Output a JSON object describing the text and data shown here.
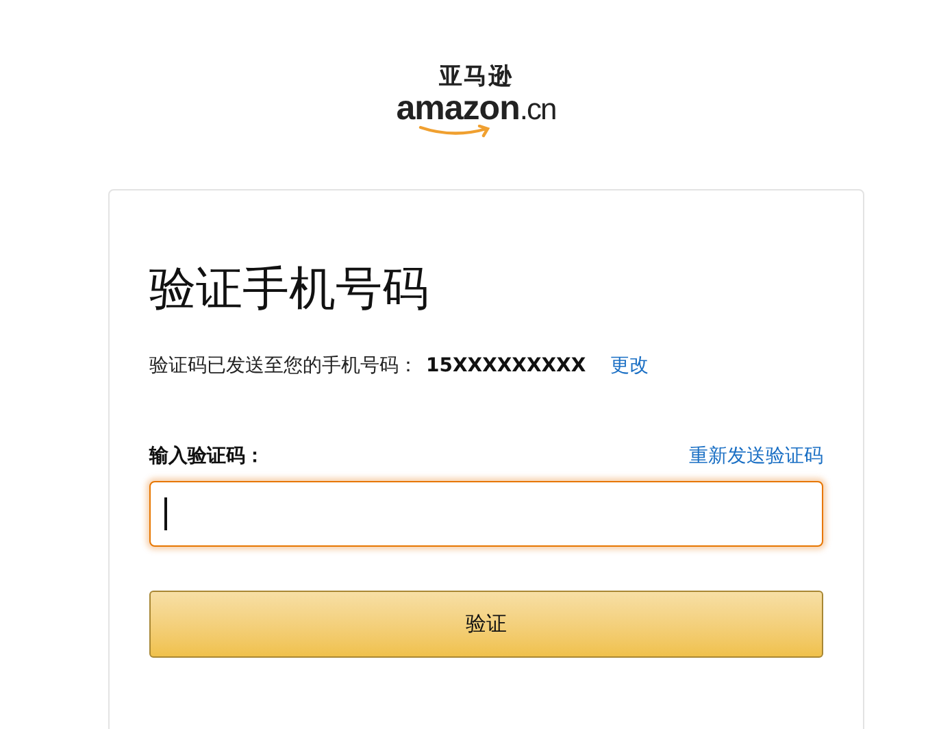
{
  "logo": {
    "chinese": "亚马逊",
    "brand": "amazon",
    "suffix": ".cn"
  },
  "card": {
    "title": "验证手机号码",
    "sent_message": "验证码已发送至您的手机号码：",
    "phone": "15XXXXXXXXX",
    "change_link": "更改",
    "code_label": "输入验证码：",
    "resend_link": "重新发送验证码",
    "code_field": {
      "focused": true
    },
    "submit_button": "验证"
  }
}
